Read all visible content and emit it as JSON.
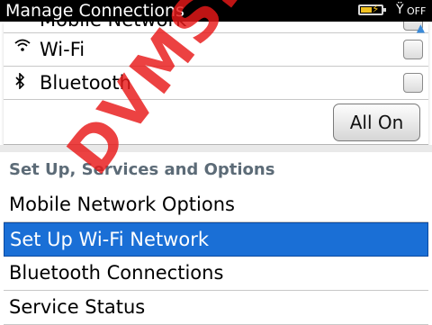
{
  "header": {
    "title": "Manage Connections",
    "battery_icon": "battery-charging-icon",
    "signal_icon": "antenna-icon",
    "radio_status": "OFF"
  },
  "toggles": [
    {
      "label": "Mobile Network",
      "icon": "mobile-network-icon"
    },
    {
      "label": "Wi-Fi",
      "icon": "wifi-icon"
    },
    {
      "label": "Bluetooth",
      "icon": "bluetooth-icon"
    }
  ],
  "all_on_label": "All On",
  "setup": {
    "header": "Set Up, Services and Options",
    "items": [
      {
        "label": "Mobile Network Options"
      },
      {
        "label": "Set Up Wi-Fi Network"
      },
      {
        "label": "Bluetooth Connections"
      },
      {
        "label": "Service Status"
      }
    ],
    "selected_index": 1
  },
  "watermark": "DVMS.VN",
  "colors": {
    "selection": "#1a6fd6",
    "watermark": "#e81818",
    "section_header": "#5c6b77"
  }
}
